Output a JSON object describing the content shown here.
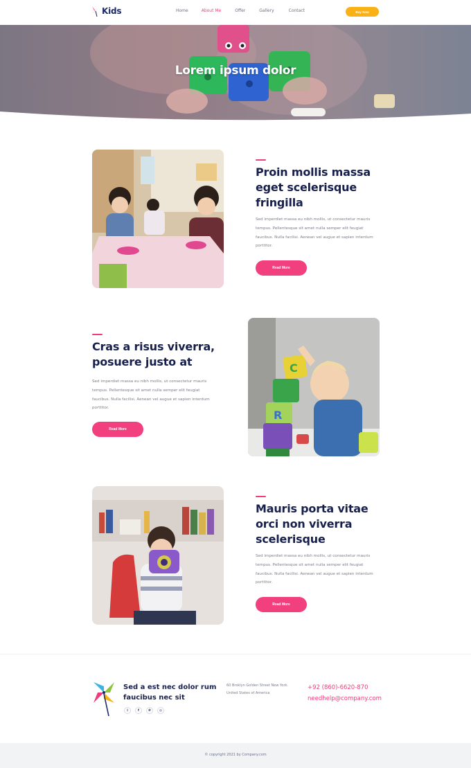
{
  "nav": {
    "logo_text": "Kids",
    "items": [
      {
        "label": "Home"
      },
      {
        "label": "About Me"
      },
      {
        "label": "Offer"
      },
      {
        "label": "Gallery"
      },
      {
        "label": "Contact"
      }
    ],
    "active_item": "About Me",
    "buy_button": "Buy Now"
  },
  "hero": {
    "title": "Lorem ipsum dolor"
  },
  "features": [
    {
      "title": "Proin mollis massa eget scelerisque fringilla",
      "text": "Sed imperdiet massa eu nibh mollis, ut consectetur mauris tempus. Pellentesque sit amet nulla semper elit feugiat faucibus. Nulla facilisi. Aenean vel augue et sapien interdum porttitor.",
      "button": "Read More"
    },
    {
      "title": "Cras a risus viverra, posuere justo at",
      "text": "Sed imperdiet massa eu nibh mollis, ut consectetur mauris tempus. Pellentesque sit amet nulla semper elit feugiat faucibus. Nulla facilisi. Aenean vel augue et sapien interdum porttitor.",
      "button": "Read More"
    },
    {
      "title": "Mauris porta vitae orci non viverra scelerisque",
      "text": "Sed imperdiet massa eu nibh mollis, ut consectetur mauris tempus. Pellentesque sit amet nulla semper elit feugiat faucibus. Nulla facilisi. Aenean vel augue et sapien interdum porttitor.",
      "button": "Read More"
    }
  ],
  "footer": {
    "tagline": "Sed a est nec dolor rum faucibus nec sit",
    "address_line1": "60 Broklyn Golden Street New York.",
    "address_line2": "United States of America",
    "phone": "+92 (860)-6620-870",
    "email": "needhelp@company.com",
    "socials": [
      {
        "icon": "twitter-icon",
        "glyph": "𝕥"
      },
      {
        "icon": "facebook-icon",
        "glyph": "f"
      },
      {
        "icon": "pinterest-icon",
        "glyph": "℗"
      },
      {
        "icon": "instagram-icon",
        "glyph": "◎"
      }
    ],
    "copyright": "© copyright 2021 by Company.com"
  },
  "colors": {
    "accent": "#f03c7c",
    "buy": "#f9b115",
    "heading": "#17204d",
    "text": "#7a7d8c"
  }
}
